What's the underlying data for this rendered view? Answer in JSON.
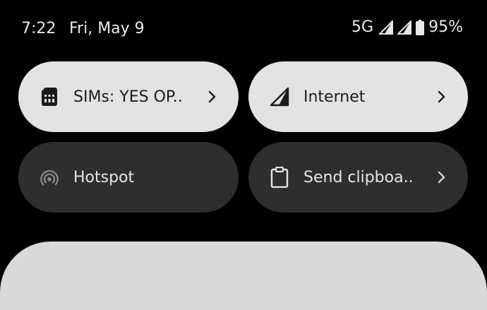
{
  "status_bar": {
    "time": "7:22",
    "date": "Fri, May 9",
    "network_type": "5G",
    "battery": "95%"
  },
  "tiles": [
    {
      "label": "SIMs: YES OP..",
      "icon": "sim-card-icon",
      "state": "on",
      "has_chevron": true
    },
    {
      "label": "Internet",
      "icon": "signal-icon",
      "state": "on",
      "has_chevron": true
    },
    {
      "label": "Hotspot",
      "icon": "hotspot-icon",
      "state": "off",
      "has_chevron": false
    },
    {
      "label": "Send clipboa..",
      "icon": "clipboard-icon",
      "state": "off",
      "has_chevron": true
    }
  ],
  "colors": {
    "background": "#000000",
    "tile_on": "#e3e3e3",
    "tile_off": "#2e2e2e",
    "panel": "#d9d9d9"
  }
}
